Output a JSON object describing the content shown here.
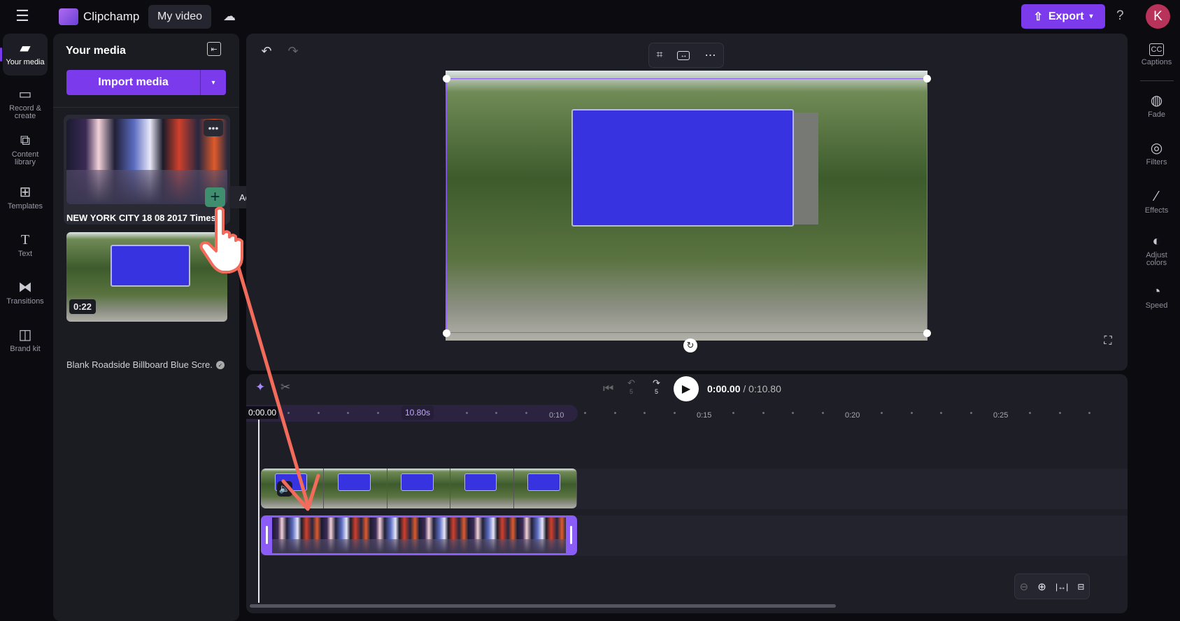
{
  "header": {
    "app_name": "Clipchamp",
    "project_name": "My video",
    "export_label": "Export",
    "help": "?",
    "avatar_initial": "K"
  },
  "nav": {
    "items": [
      {
        "label": "Your media",
        "icon": "folder-icon",
        "selected": true
      },
      {
        "label": "Record & create",
        "icon": "camera-icon"
      },
      {
        "label": "Content library",
        "icon": "content-library-icon"
      },
      {
        "label": "Templates",
        "icon": "templates-icon"
      },
      {
        "label": "Text",
        "icon": "text-icon"
      },
      {
        "label": "Transitions",
        "icon": "transitions-icon"
      },
      {
        "label": "Brand kit",
        "icon": "brand-kit-icon"
      }
    ]
  },
  "media": {
    "title": "Your media",
    "import_label": "Import media",
    "items": [
      {
        "title": "NEW YORK CITY 18 08 2017 Times...",
        "duration": ""
      },
      {
        "title": "Blank Roadside Billboard Blue Scre...",
        "duration": "0:22"
      }
    ],
    "tooltip": "Add to timeline"
  },
  "preview": {
    "toolbar": [
      "crop-icon",
      "fit-icon",
      "more-icon"
    ]
  },
  "timeline": {
    "current_time": "0:00.00",
    "separator": "/",
    "total_time": "0:10.80",
    "playhead_label": "0:00.00",
    "clip_duration": "10.80s",
    "ruler_ticks": [
      "0:10",
      "0:15",
      "0:20",
      "0:25"
    ],
    "skip_back_label": "5",
    "skip_forward_label": "5"
  },
  "right_panel": {
    "items": [
      {
        "label": "Captions",
        "icon": "captions-icon"
      },
      {
        "label": "Fade",
        "icon": "fade-icon"
      },
      {
        "label": "Filters",
        "icon": "filters-icon"
      },
      {
        "label": "Effects",
        "icon": "effects-icon"
      },
      {
        "label": "Adjust colors",
        "icon": "adjust-colors-icon"
      },
      {
        "label": "Speed",
        "icon": "speed-icon"
      }
    ]
  },
  "colors": {
    "accent": "#7c3aed",
    "annotation_arrow": "#f26b5b",
    "add_button": "#3f8f6e",
    "billboard_blue": "#3833e0"
  }
}
